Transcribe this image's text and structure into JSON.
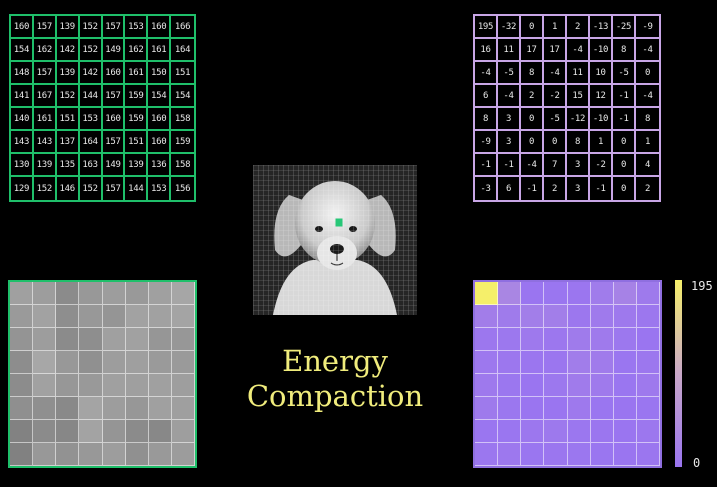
{
  "title": {
    "line1": "Energy",
    "line2": "Compaction"
  },
  "pixel_values": [
    [
      "160",
      "157",
      "139",
      "152",
      "157",
      "153",
      "160",
      "166"
    ],
    [
      "154",
      "162",
      "142",
      "152",
      "149",
      "162",
      "161",
      "164"
    ],
    [
      "148",
      "157",
      "139",
      "142",
      "160",
      "161",
      "150",
      "151"
    ],
    [
      "141",
      "167",
      "152",
      "144",
      "157",
      "159",
      "154",
      "154"
    ],
    [
      "140",
      "161",
      "151",
      "153",
      "160",
      "159",
      "160",
      "158"
    ],
    [
      "143",
      "143",
      "137",
      "164",
      "157",
      "151",
      "160",
      "159"
    ],
    [
      "130",
      "139",
      "135",
      "163",
      "149",
      "139",
      "136",
      "158"
    ],
    [
      "129",
      "152",
      "146",
      "152",
      "157",
      "144",
      "153",
      "156"
    ]
  ],
  "dct_coefficients": [
    [
      "195",
      "-32",
      "0",
      "1",
      "2",
      "-13",
      "-25",
      "-9"
    ],
    [
      "16",
      "11",
      "17",
      "17",
      "-4",
      "-10",
      "8",
      "-4"
    ],
    [
      "-4",
      "-5",
      "8",
      "-4",
      "11",
      "10",
      "-5",
      "0"
    ],
    [
      "6",
      "-4",
      "2",
      "-2",
      "15",
      "12",
      "-1",
      "-4"
    ],
    [
      "8",
      "3",
      "0",
      "-5",
      "-12",
      "-10",
      "-1",
      "8"
    ],
    [
      "-9",
      "3",
      "0",
      "0",
      "8",
      "1",
      "0",
      "1"
    ],
    [
      "-1",
      "-1",
      "-4",
      "7",
      "3",
      "-2",
      "0",
      "4"
    ],
    [
      "-3",
      "6",
      "-1",
      "2",
      "3",
      "-1",
      "0",
      "2"
    ]
  ],
  "colorbar": {
    "max_label": "195",
    "min_label": "0",
    "max_value": 195,
    "min_value": 0
  },
  "colors": {
    "green_border": "#1fbf6a",
    "purple_border": "#c8a6e6",
    "title_color": "#f0ec7c",
    "colormap_high": "#f5ef6a",
    "colormap_low": "#9a75f0"
  }
}
